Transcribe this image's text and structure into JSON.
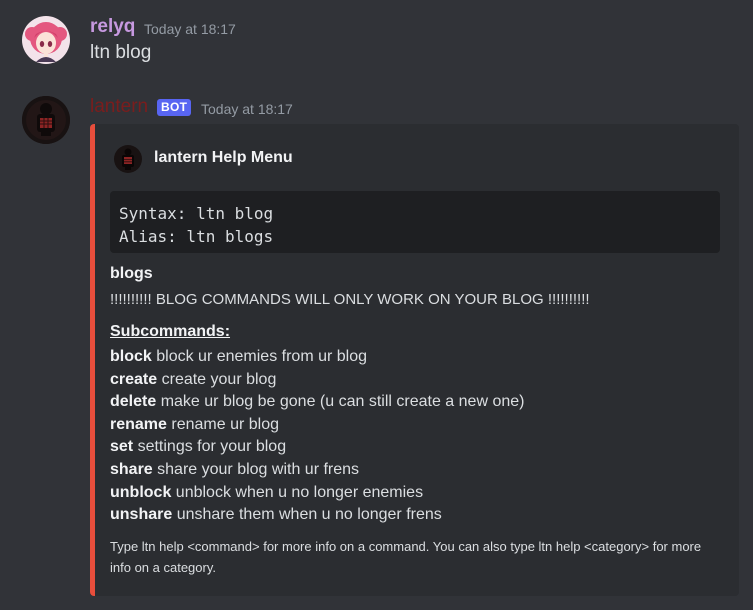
{
  "messages": [
    {
      "username": "relyq",
      "username_color": "#c799e0",
      "timestamp": "Today at 18:17",
      "content": "ltn blog"
    },
    {
      "username": "lantern",
      "username_color": "#7a1d1d",
      "bot_tag": "BOT",
      "timestamp": "Today at 18:17"
    }
  ],
  "embed": {
    "accent_color": "#e84e3c",
    "author": "lantern Help Menu",
    "code_lines": [
      "Syntax: ltn blog",
      "Alias: ltn blogs"
    ],
    "field_name": "blogs",
    "warning": "!!!!!!!!!! BLOG COMMANDS WILL ONLY WORK ON YOUR BLOG !!!!!!!!!!",
    "subcommands_heading": "Subcommands:",
    "subcommands": [
      {
        "name": "block",
        "desc": "block ur enemies from ur blog"
      },
      {
        "name": "create",
        "desc": "create your blog"
      },
      {
        "name": "delete",
        "desc": "make ur blog be gone (u can still create a new one)"
      },
      {
        "name": "rename",
        "desc": "rename ur blog"
      },
      {
        "name": "set",
        "desc": "settings for your blog"
      },
      {
        "name": "share",
        "desc": "share your blog with ur frens"
      },
      {
        "name": "unblock",
        "desc": "unblock when u no longer enemies"
      },
      {
        "name": "unshare",
        "desc": "unshare them when u no longer frens"
      }
    ],
    "footer": "Type ltn help <command> for more info on a command. You can also type ltn help <category> for more info on a category."
  },
  "icons": {
    "user_avatar": "anime-girl-avatar-icon",
    "bot_avatar": "lantern-avatar-icon"
  }
}
